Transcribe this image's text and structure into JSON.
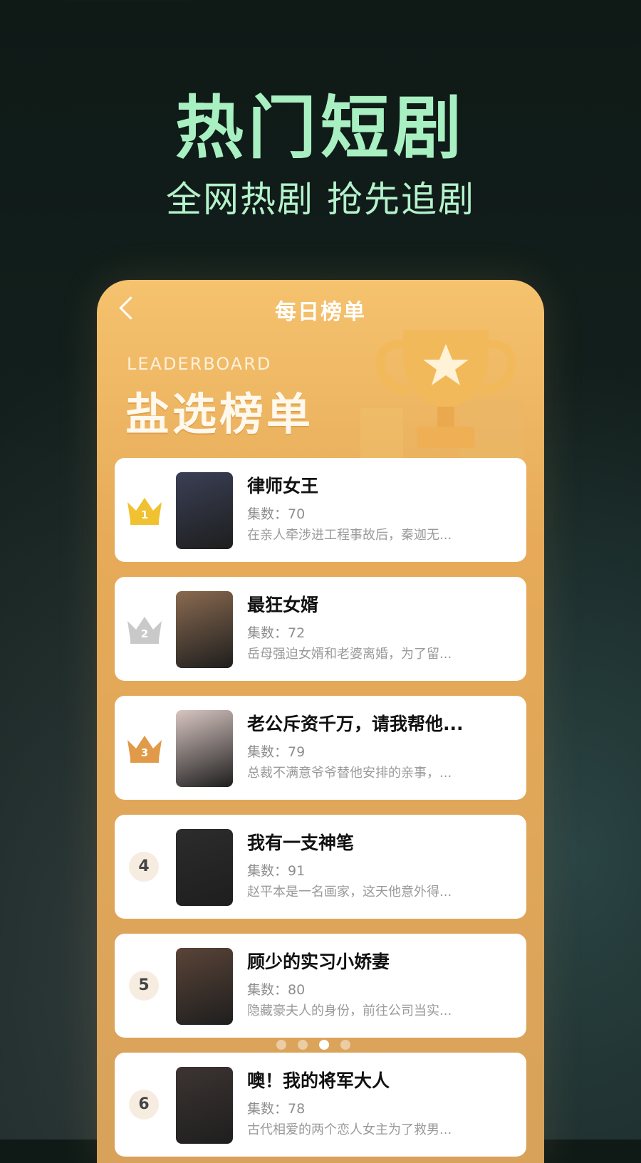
{
  "promo": {
    "title": "热门短剧",
    "subtitle": "全网热剧 抢先追剧"
  },
  "app": {
    "nav_title": "每日榜单",
    "banner_en": "LEADERBOARD",
    "banner_cn": "盐选榜单"
  },
  "items": [
    {
      "rank": "1",
      "title": "律师女王",
      "episodes": "集数：70",
      "desc": "在亲人牵涉进工程事故后，秦迦无...",
      "poster_color": "#3a3f55",
      "rank_color": "#f0c232"
    },
    {
      "rank": "2",
      "title": "最狂女婿",
      "episodes": "集数：72",
      "desc": "岳母强迫女婿和老婆离婚，为了留...",
      "poster_color": "#8a6a50",
      "rank_color": "#c9c9c9"
    },
    {
      "rank": "3",
      "title": "老公斥资千万，请我帮他...",
      "episodes": "集数：79",
      "desc": "总裁不满意爷爷替他安排的亲事，...",
      "poster_color": "#d8c6c2",
      "rank_color": "#e09a48"
    },
    {
      "rank": "4",
      "title": "我有一支神笔",
      "episodes": "集数：91",
      "desc": "赵平本是一名画家，这天他意外得...",
      "poster_color": "#2c2c2c",
      "rank_color": ""
    },
    {
      "rank": "5",
      "title": "顾少的实习小娇妻",
      "episodes": "集数：80",
      "desc": "隐藏豪夫人的身份，前往公司当实...",
      "poster_color": "#5a4438",
      "rank_color": ""
    },
    {
      "rank": "6",
      "title": "噢！我的将军大人",
      "episodes": "集数：78",
      "desc": "古代相爱的两个恋人女主为了救男...",
      "poster_color": "#3c3432",
      "rank_color": ""
    }
  ],
  "pager": {
    "count": 4,
    "active": 3
  }
}
